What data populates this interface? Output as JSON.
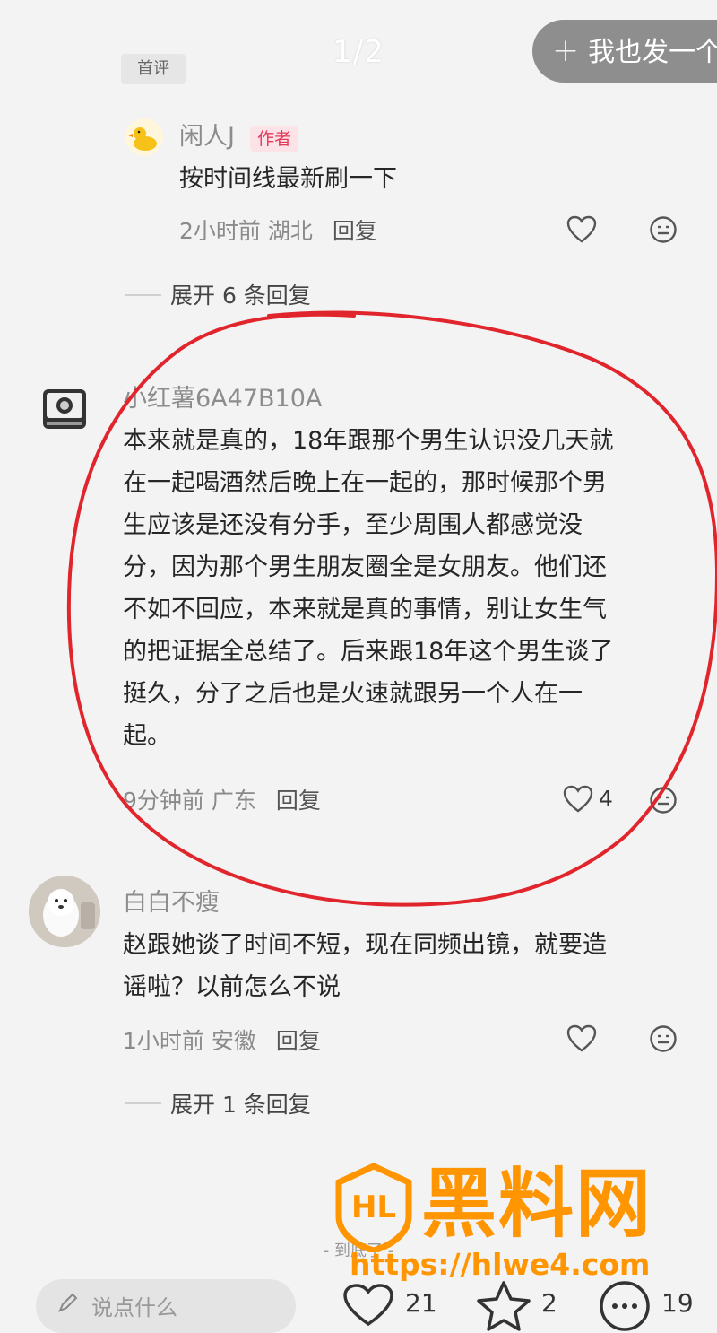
{
  "top": {
    "page_indicator": "1/2",
    "post_button_plus": "+",
    "post_button_label": "我也发一个",
    "first_comment_tag": "首评"
  },
  "comments": [
    {
      "username": "闲人J",
      "badge": "作者",
      "text": "按时间线最新刷一下",
      "time": "2小时前",
      "location": "湖北",
      "reply_label": "回复",
      "expand_label": "展开 6 条回复"
    },
    {
      "username": "小红薯6A47B10A",
      "lines": [
        "本来就是真的，18年跟那个男生认识没几天就",
        "在一起喝酒然后晚上在一起的，那时候那个男",
        "生应该是还没有分手，至少周围人都感觉没",
        "分，因为那个男生朋友圈全是女朋友。他们还",
        "不如不回应，本来就是真的事情，别让女生气",
        "的把证据全总结了。后来跟18年这个男生谈了",
        "挺久，分了之后也是火速就跟另一个人在一",
        "起。"
      ],
      "time": "9分钟前",
      "location": "广东",
      "reply_label": "回复",
      "like_count": "4"
    },
    {
      "username": "白白不瘦",
      "lines": [
        "赵跟她谈了时间不短，现在同频出镜，就要造",
        "谣啦？以前怎么不说"
      ],
      "time": "1小时前",
      "location": "安徽",
      "reply_label": "回复",
      "expand_label": "展开 1 条回复"
    }
  ],
  "end_text": "- 到底了 -",
  "bottom_bar": {
    "input_placeholder": "说点什么",
    "like_count": "21",
    "star_count": "2",
    "comment_count": "19"
  },
  "watermark": {
    "logo_letters": "HL",
    "brand": "黑料网",
    "url": "https://hlwe4.com"
  },
  "colors": {
    "background": "#f3f3f3",
    "annotation_red": "#e0262c",
    "watermark_orange": "#ff9500",
    "author_badge": "#e5385a"
  }
}
